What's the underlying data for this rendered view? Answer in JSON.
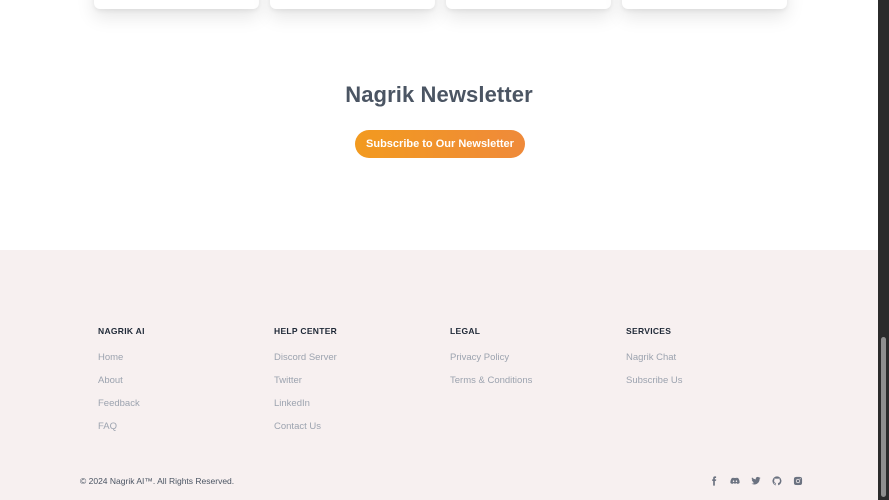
{
  "newsletter": {
    "title": "Nagrik Newsletter",
    "button_label": "Subscribe to Our Newsletter"
  },
  "footer": {
    "columns": [
      {
        "heading": "NAGRIK AI",
        "links": [
          "Home",
          "About",
          "Feedback",
          "FAQ"
        ]
      },
      {
        "heading": "HELP CENTER",
        "links": [
          "Discord Server",
          "Twitter",
          "LinkedIn",
          "Contact Us"
        ]
      },
      {
        "heading": "LEGAL",
        "links": [
          "Privacy Policy",
          "Terms & Conditions"
        ]
      },
      {
        "heading": "SERVICES",
        "links": [
          "Nagrik Chat",
          "Subscribe Us"
        ]
      }
    ],
    "copyright": "© 2024 Nagrik AI™. All Rights Reserved.",
    "socials": [
      "facebook-icon",
      "discord-icon",
      "twitter-icon",
      "github-icon",
      "instagram-icon"
    ]
  },
  "colors": {
    "accent": "#f29a1f",
    "footer_bg": "#f7f0f0",
    "heading": "#4b5563",
    "link": "#9ca3af"
  }
}
